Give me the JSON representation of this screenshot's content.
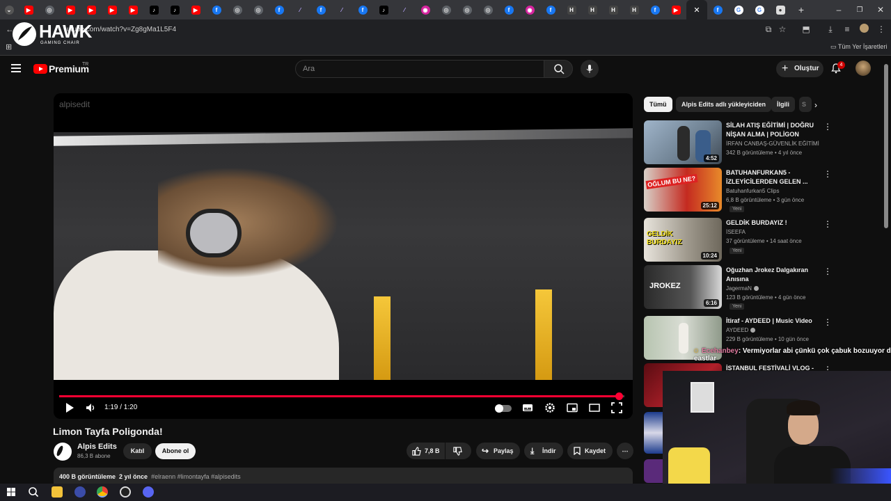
{
  "browser": {
    "url": "utube.com/watch?v=Zg8gMa1L5F4",
    "bookmarks_label": "Tüm Yer İşaretleri",
    "tab_icons": [
      "youtube-icon",
      "globe-icon",
      "youtube-icon",
      "youtube-icon",
      "youtube-icon",
      "youtube-icon",
      "tiktok-icon",
      "tiktok-icon",
      "youtube-icon",
      "facebook-icon",
      "globe-icon",
      "globe-icon",
      "facebook-icon",
      "feather-icon",
      "facebook-icon",
      "feather-icon",
      "facebook-icon",
      "tiktok-icon",
      "feather-icon",
      "instagram-icon",
      "globe-icon",
      "globe-icon",
      "globe-icon",
      "facebook-icon",
      "instagram-icon",
      "facebook-icon",
      "h-icon",
      "h-icon",
      "h-icon",
      "h-icon",
      "facebook-icon",
      "youtube-icon"
    ]
  },
  "overlay_logo": {
    "title": "HAWK",
    "subtitle": "GAMING CHAIR"
  },
  "header": {
    "brand": "Premium",
    "region": "TR",
    "search_placeholder": "Ara",
    "create_label": "Oluştur",
    "notification_count": "4"
  },
  "player": {
    "watermark": "alpisedit",
    "time": "1:19 / 1:20",
    "progress": 0.99
  },
  "video": {
    "title": "Limon Tayfa Poligonda!",
    "channel": "Alpis Edits",
    "subscribers": "86,3 B abone",
    "join_label": "Katıl",
    "subscribe_label": "Abone ol",
    "likes": "7,8 B",
    "share_label": "Paylaş",
    "download_label": "İndir",
    "save_label": "Kaydet",
    "views": "400 B görüntüleme",
    "age": "2 yıl önce",
    "hashtags": "#elraenn #limontayfa #alpisedits"
  },
  "chips": [
    "Tümü",
    "Alpis Edits adlı yükleyiciden",
    "İlgili",
    "S"
  ],
  "recommendations": [
    {
      "title": "SİLAH ATIŞ EĞİTİMİ | DOĞRU NİŞAN ALMA | POLİGON",
      "channel": "İRFAN CANBAŞ-GÜVENLİK EĞİTİMİ",
      "meta": "342 B görüntüleme • 4 yıl önce",
      "duration": "4:52",
      "new": ""
    },
    {
      "title": "BATUHANFURKAN5 - İZLEYİCİLERDEN GELEN ...",
      "channel": "Batuhanfurkan5 Clips",
      "meta": "6,8 B görüntüleme • 3 gün önce",
      "duration": "25:12",
      "new": "Yeni",
      "thumb_text": "OĞLUM BU NE?"
    },
    {
      "title": "GELDİK BURDAYIZ !",
      "channel": "İSEEFA",
      "meta": "37 görüntüleme • 14 saat önce",
      "duration": "10:24",
      "new": "Yeni",
      "thumb_text": "GELDİK BURDAYIZ"
    },
    {
      "title": "Oğuzhan Jrokez Dalgakıran Anısına",
      "channel": "JagermaN",
      "meta": "123 B görüntüleme • 4 gün önce",
      "duration": "6:16",
      "new": "Yeni",
      "thumb_text": "JROKEZ"
    },
    {
      "title": "İtiraf - AYDEED | Music Video",
      "channel": "AYDEED",
      "meta": "229 B görüntüleme • 10 gün önce",
      "duration": "",
      "new": ""
    },
    {
      "title": "İSTANBUL FESTİVALİ VLOG -",
      "channel": "",
      "meta": "",
      "duration": "",
      "new": ""
    }
  ],
  "chat": {
    "user": "Ecehanbey",
    "message": ": Vermiyorlar abi çünkü çok çabuk bozuuyor deagle",
    "message_line2": "eastlar"
  },
  "colors": {
    "accent": "#ff0033",
    "background": "#0f0f0f",
    "surface": "#272727"
  }
}
